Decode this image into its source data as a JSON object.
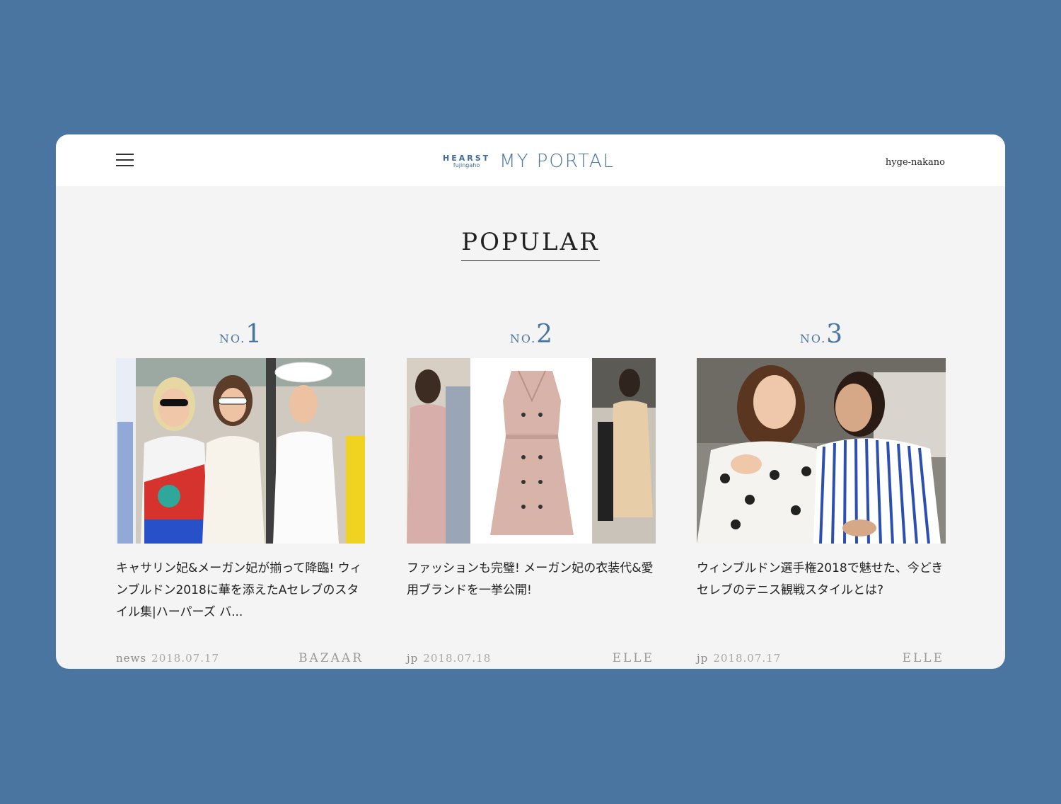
{
  "header": {
    "logo_brand": "HEARST",
    "logo_sub": "fujingaho",
    "logo_title": "MY PORTAL",
    "username": "hyge-nakano"
  },
  "section": {
    "title": "POPULAR"
  },
  "articles": [
    {
      "rank_label": "NO.",
      "rank_number": "1",
      "title": "キャサリン妃&メーガン妃が揃って降臨! ウィンブルドン2018に華を添えたAセレブのスタイル集|ハーパーズ バ...",
      "category": "news",
      "date": "2018.07.17",
      "brand": "BAZAAR"
    },
    {
      "rank_label": "NO.",
      "rank_number": "2",
      "title": "ファッションも完璧! メーガン妃の衣装代&愛用ブランドを一挙公開!",
      "category": "jp",
      "date": "2018.07.18",
      "brand": "ELLE"
    },
    {
      "rank_label": "NO.",
      "rank_number": "3",
      "title": "ウィンブルドン選手権2018で魅せた、今どきセレブのテニス観戦スタイルとは?",
      "category": "jp",
      "date": "2018.07.17",
      "brand": "ELLE"
    }
  ],
  "colors": {
    "page_bg": "#4a75a1",
    "accent": "#4a75a1",
    "panel_bg": "#f4f4f4"
  }
}
